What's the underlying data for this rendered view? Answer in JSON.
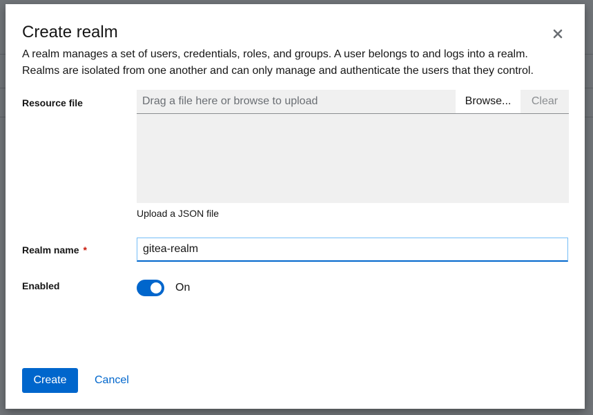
{
  "dialog": {
    "title": "Create realm",
    "close_icon": "close-icon",
    "description_line1": "A realm manages a set of users, credentials, roles, and groups. A user belongs to and logs into a realm.",
    "description_line2": "Realms are isolated from one another and can only manage and authenticate the users that they control."
  },
  "form": {
    "resource_file": {
      "label": "Resource file",
      "placeholder": "Drag a file here or browse to upload",
      "browse_label": "Browse...",
      "clear_label": "Clear",
      "helper_text": "Upload a JSON file"
    },
    "realm_name": {
      "label": "Realm name",
      "required_marker": "*",
      "value": "gitea-realm"
    },
    "enabled": {
      "label": "Enabled",
      "state_label": "On",
      "checked": true
    }
  },
  "actions": {
    "create_label": "Create",
    "cancel_label": "Cancel"
  },
  "colors": {
    "primary": "#0066cc",
    "required": "#c9190b",
    "overlay": "#707478",
    "upload_bg": "#f0f0f0"
  }
}
